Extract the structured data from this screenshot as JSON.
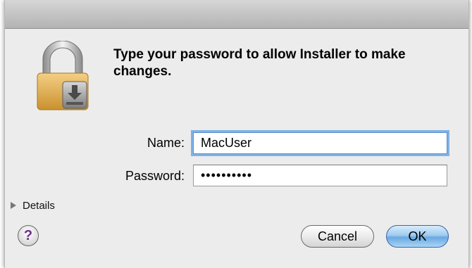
{
  "dialog": {
    "prompt": "Type your password to allow Installer to make changes.",
    "icon": "lock-installer-icon"
  },
  "form": {
    "name_label": "Name:",
    "name_value": "MacUser",
    "password_label": "Password:",
    "password_value": "••••••••••"
  },
  "details": {
    "label": "Details",
    "icon": "disclosure-triangle-icon"
  },
  "buttons": {
    "help": "?",
    "cancel": "Cancel",
    "ok": "OK"
  },
  "colors": {
    "ok_button": "#7fb6e8",
    "focus_ring": "#7fb2e5",
    "help_glyph": "#6b2f8e"
  }
}
